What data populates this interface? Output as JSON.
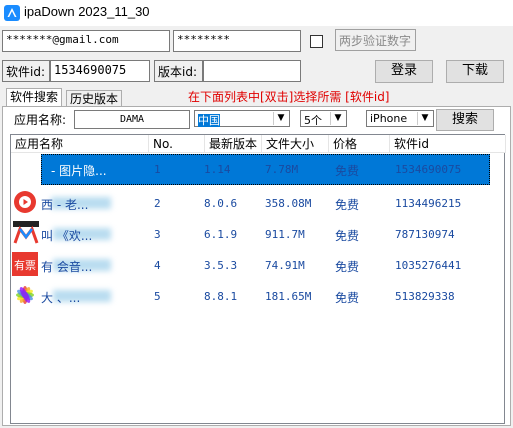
{
  "window": {
    "title": "ipaDown 2023_11_30"
  },
  "login": {
    "email": "*******@gmail.com",
    "password": "********",
    "twofa_placeholder": "两步验证数字",
    "login_button": "登录",
    "download_button": "下载"
  },
  "ids": {
    "software_id_label": "软件id:",
    "software_id_value": "1534690075",
    "version_id_label": "版本id:",
    "version_id_value": ""
  },
  "tabs": [
    "软件搜索",
    "历史版本"
  ],
  "hint": "在下面列表中[双击]选择所需 [软件id]",
  "search": {
    "app_name_label": "应用名称:",
    "app_name_value": "DAMA",
    "region": "中国",
    "count": "5个",
    "device": "iPhone",
    "search_button": "搜索"
  },
  "table": {
    "columns": [
      "应用名称",
      "No.",
      "最新版本",
      "文件大小",
      "价格",
      "软件id"
    ],
    "rows": [
      {
        "name": "- 图片隐...",
        "no": "1",
        "version": "1.14",
        "size": "7.78M",
        "price": "免费",
        "id": "1534690075",
        "icon": "white-app-icon",
        "selected": true
      },
      {
        "name": "西    - 老...",
        "no": "2",
        "version": "8.0.6",
        "size": "358.08M",
        "price": "免费",
        "id": "1134496215",
        "icon": "red-play-icon",
        "selected": false
      },
      {
        "name": "叫    《欢...",
        "no": "3",
        "version": "6.1.9",
        "size": "911.7M",
        "price": "免费",
        "id": "787130974",
        "icon": "m-logo-icon",
        "selected": false
      },
      {
        "name": "有    会音...",
        "no": "4",
        "version": "3.5.3",
        "size": "74.91M",
        "price": "免费",
        "id": "1035276441",
        "icon": "youpiao-icon",
        "selected": false
      },
      {
        "name": "大    、...",
        "no": "5",
        "version": "8.8.1",
        "size": "181.65M",
        "price": "免费",
        "id": "513829338",
        "icon": "colorful-flower-icon",
        "selected": false
      }
    ]
  },
  "colors": {
    "selection": "#0078d7",
    "hint": "#e00000",
    "text_blue": "#1a4aa0"
  }
}
